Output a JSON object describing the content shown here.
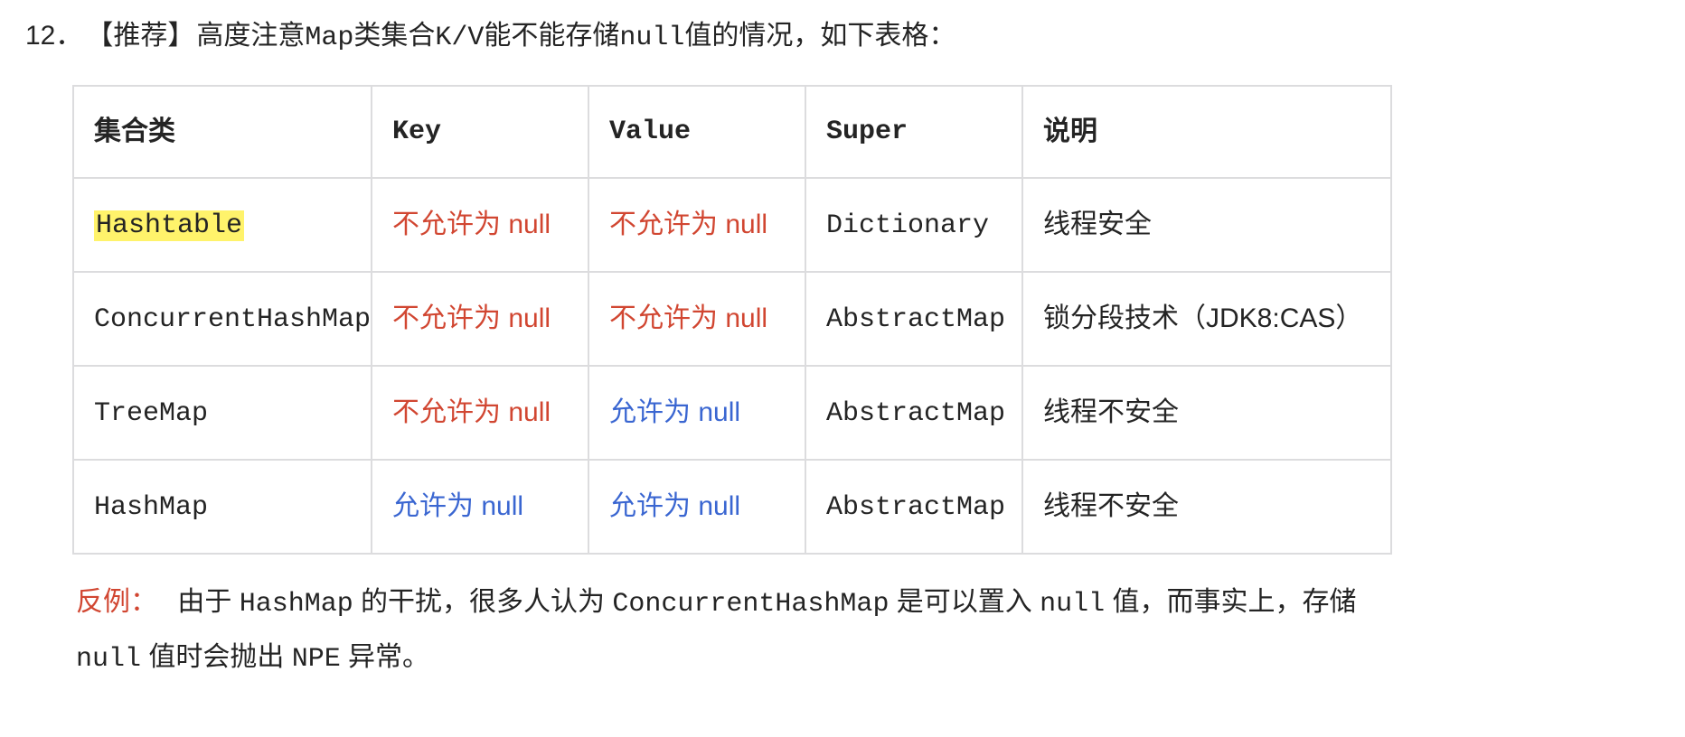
{
  "heading": {
    "number": "12．",
    "tag": "【推荐】",
    "text_pre": "高度注意 ",
    "word_map": "Map",
    "text_mid1": " 类集合 ",
    "word_kv": "K/V",
    "text_mid2": " 能不能存储 ",
    "word_null": "null",
    "text_post": " 值的情况，如下表格："
  },
  "table": {
    "headers": [
      "集合类",
      "Key",
      "Value",
      "Super",
      "说明"
    ],
    "rows": [
      {
        "cls": {
          "text": "Hashtable",
          "highlight": true,
          "mono": true
        },
        "key": {
          "text": "不允许为 null",
          "color": "red"
        },
        "value": {
          "text": "不允许为 null",
          "color": "red"
        },
        "super": {
          "text": "Dictionary",
          "mono": true
        },
        "note": {
          "text": "线程安全"
        }
      },
      {
        "cls": {
          "text": "ConcurrentHashMap",
          "highlight": false,
          "mono": true
        },
        "key": {
          "text": "不允许为 null",
          "color": "red"
        },
        "value": {
          "text": "不允许为 null",
          "color": "red"
        },
        "super": {
          "text": "AbstractMap",
          "mono": true
        },
        "note": {
          "text": "锁分段技术（JDK8:CAS）"
        }
      },
      {
        "cls": {
          "text": "TreeMap",
          "highlight": false,
          "mono": true
        },
        "key": {
          "text": "不允许为 null",
          "color": "red"
        },
        "value": {
          "text": "允许为 null",
          "color": "blue"
        },
        "super": {
          "text": "AbstractMap",
          "mono": true
        },
        "note": {
          "text": "线程不安全"
        }
      },
      {
        "cls": {
          "text": "HashMap",
          "highlight": false,
          "mono": true
        },
        "key": {
          "text": "允许为 null",
          "color": "blue"
        },
        "value": {
          "text": "允许为 null",
          "color": "blue"
        },
        "super": {
          "text": "AbstractMap",
          "mono": true
        },
        "note": {
          "text": "线程不安全"
        }
      }
    ]
  },
  "footnote": {
    "lead": "反例：",
    "seg1": "由于 ",
    "w_hashmap": "HashMap",
    "seg2": " 的干扰，很多人认为 ",
    "w_chm": "ConcurrentHashMap",
    "seg3": " 是可以置入 ",
    "w_null1": "null",
    "seg4": " 值，而事实上，存储 ",
    "w_null2": "null",
    "seg5": " 值时会抛出 ",
    "w_npe": "NPE",
    "seg6": " 异常。"
  }
}
